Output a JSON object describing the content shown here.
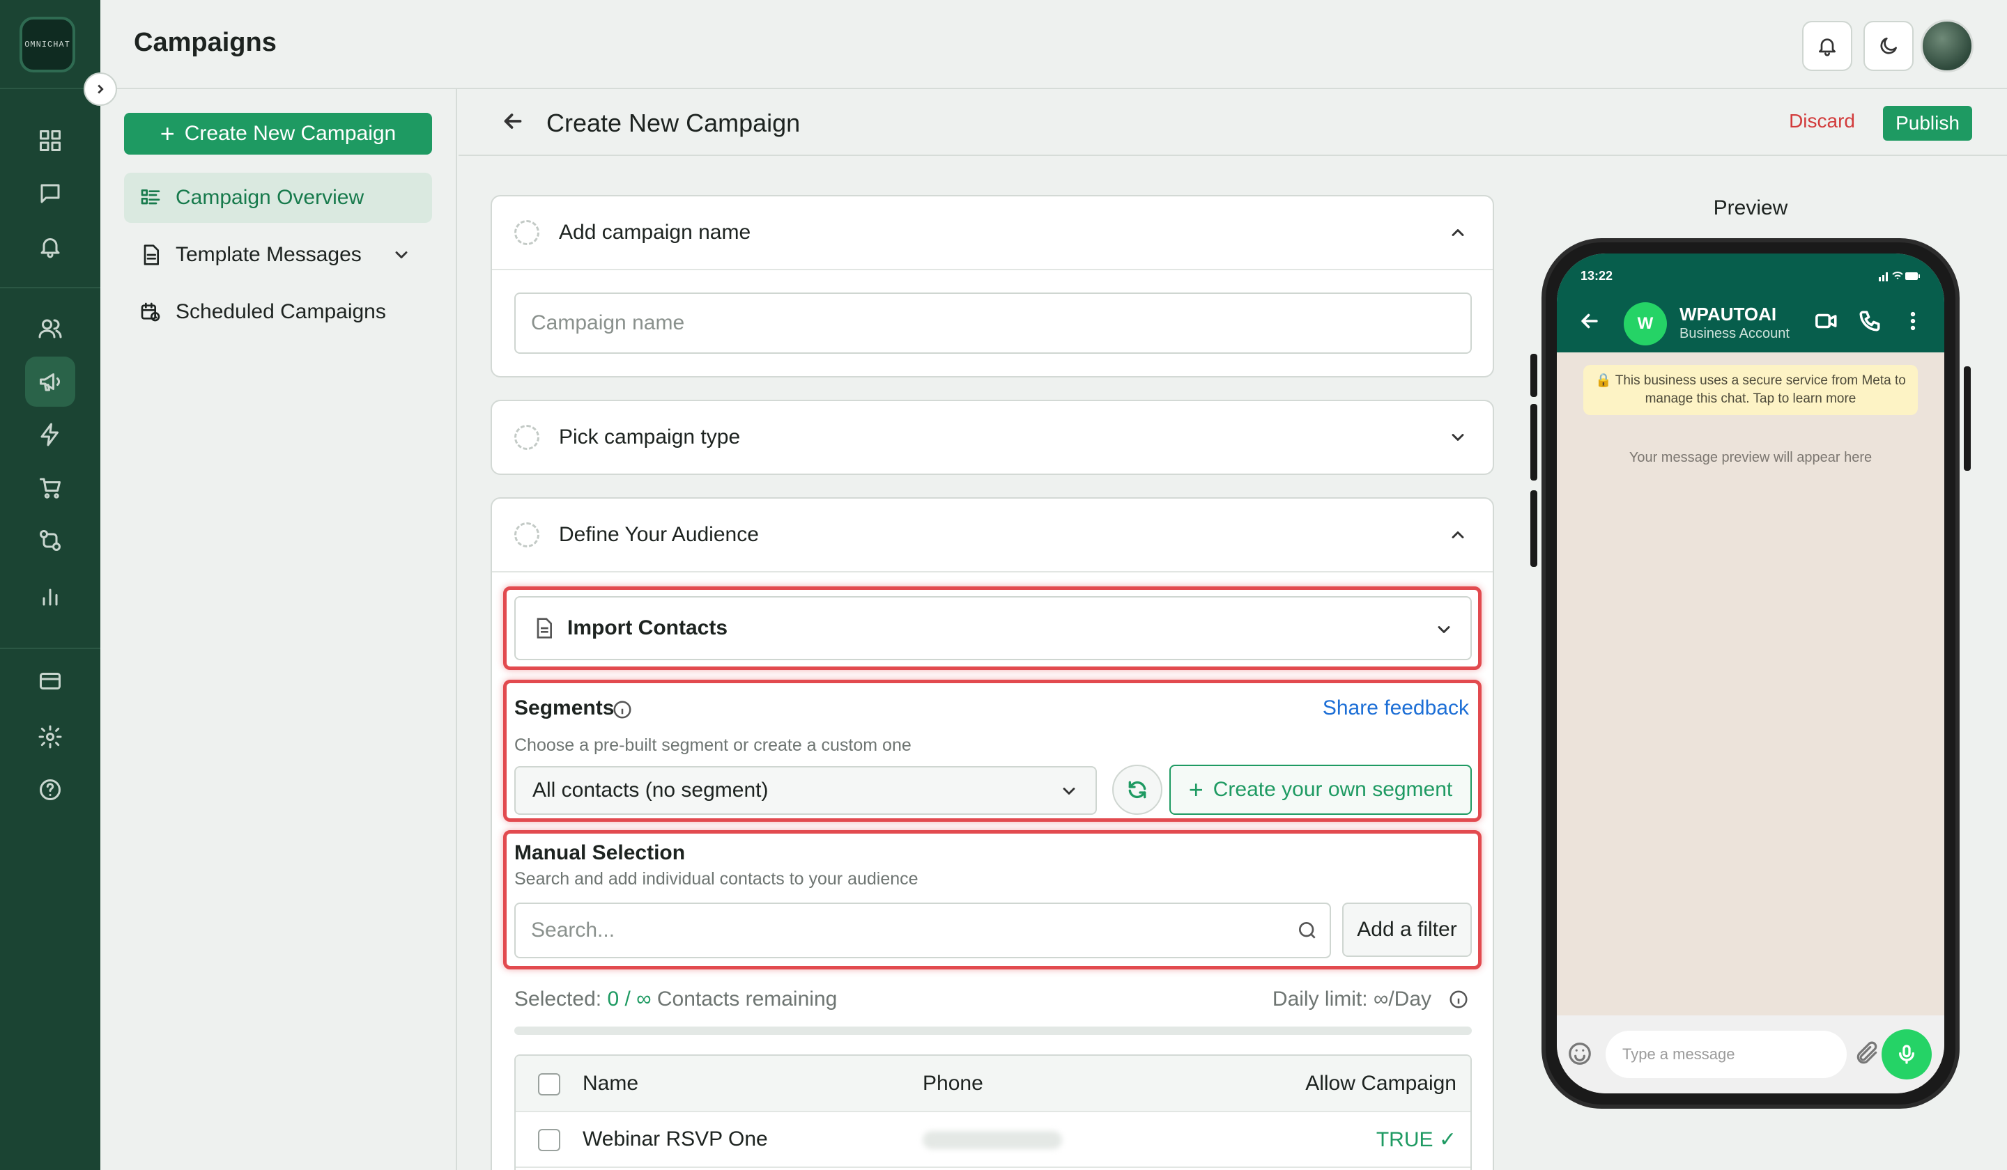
{
  "app": {
    "logo_text": "OMNICHAT"
  },
  "header": {
    "title": "Campaigns"
  },
  "rail": {
    "icons": [
      "dashboard-icon",
      "chat-icon",
      "bell-icon",
      "contacts-icon",
      "megaphone-icon",
      "lightning-icon",
      "cart-icon",
      "flow-icon",
      "analytics-icon",
      "billing-icon",
      "settings-icon",
      "help-icon"
    ],
    "active": "megaphone-icon"
  },
  "subnav": {
    "create_label": "Create New Campaign",
    "items": [
      {
        "label": "Campaign Overview",
        "active": true
      },
      {
        "label": "Template Messages",
        "active": false
      },
      {
        "label": "Scheduled Campaigns",
        "active": false
      }
    ]
  },
  "page": {
    "title": "Create New Campaign",
    "discard_label": "Discard",
    "publish_label": "Publish"
  },
  "sections": {
    "name": {
      "title": "Add campaign name",
      "placeholder": "Campaign name"
    },
    "type": {
      "title": "Pick campaign type"
    },
    "audience": {
      "title": "Define Your Audience",
      "import_label": "Import Contacts",
      "segments_label": "Segments",
      "share_feedback": "Share feedback",
      "segments_hint": "Choose a pre-built segment or create a custom one",
      "segment_selected": "All contacts (no segment)",
      "create_segment_label": "Create your own segment",
      "manual_title": "Manual Selection",
      "manual_hint": "Search and add individual contacts to your audience",
      "search_placeholder": "Search...",
      "filter_label": "Add a filter",
      "selected_prefix": "Selected:",
      "selected_count": "0 / ∞",
      "remaining_label": "Contacts remaining",
      "daily_limit": "Daily limit: ∞/Day",
      "selected_fraction": 0
    }
  },
  "table": {
    "columns": [
      "Name",
      "Phone",
      "Allow Campaign"
    ],
    "rows": [
      {
        "name": "Webinar RSVP One",
        "allow": "TRUE ✓"
      }
    ]
  },
  "preview": {
    "title": "Preview",
    "time": "13:22",
    "avatar_letter": "W",
    "contact_name": "WPAUTOAI",
    "contact_sub": "Business Account",
    "security_note": "🔒 This business uses a secure service from Meta to manage this chat. Tap to learn more",
    "empty_text": "Your message preview will appear here",
    "input_placeholder": "Type a message"
  },
  "colors": {
    "accent": "#1e9a62",
    "rail": "#1b4433",
    "danger": "#d23b3b",
    "link": "#1d6fd6",
    "highlight": "#e24a4f"
  }
}
